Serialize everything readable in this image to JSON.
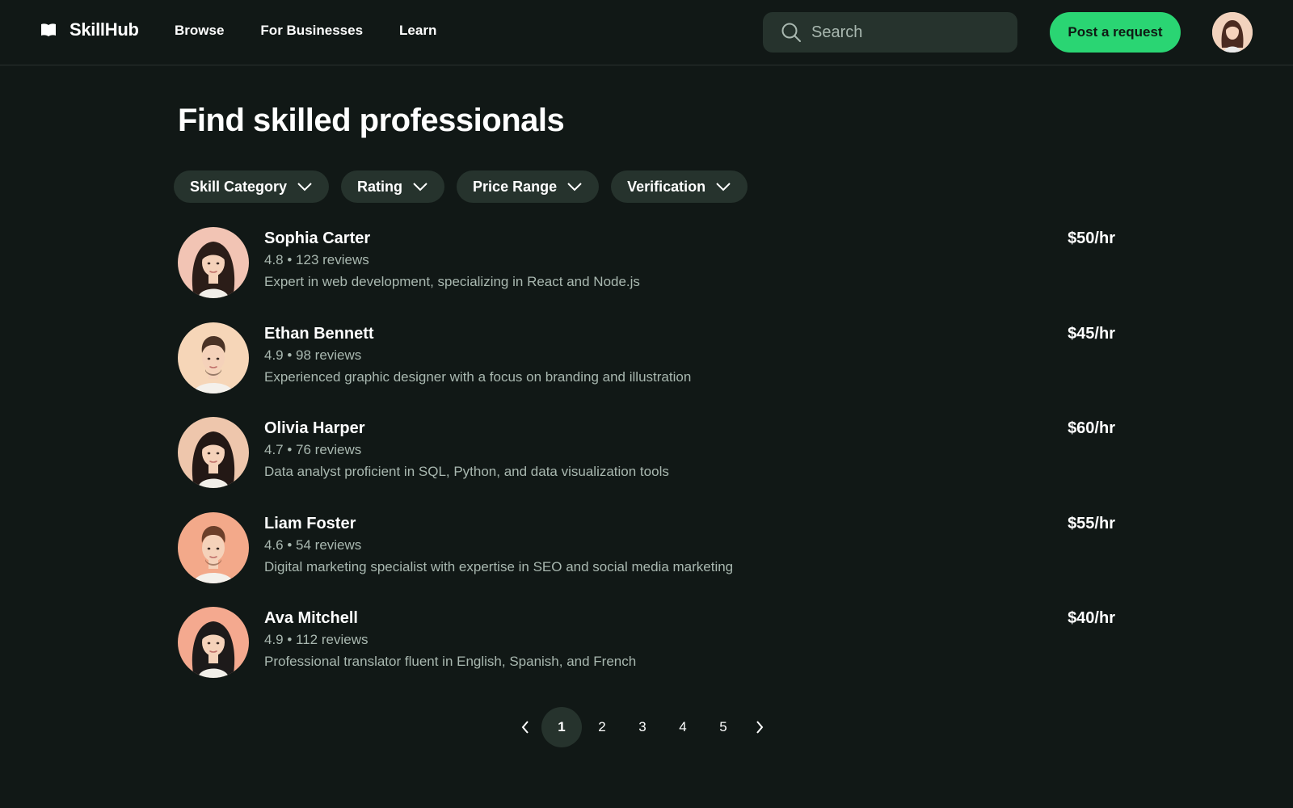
{
  "header": {
    "brand": "SkillHub",
    "nav": [
      "Browse",
      "For Businesses",
      "Learn"
    ],
    "search_placeholder": "Search",
    "post_button": "Post a request"
  },
  "main": {
    "title": "Find skilled professionals",
    "filters": [
      "Skill Category",
      "Rating",
      "Price Range",
      "Verification"
    ],
    "professionals": [
      {
        "name": "Sophia Carter",
        "rating": "4.8",
        "reviews": "123 reviews",
        "rating_line": "4.8 • 123 reviews",
        "description": "Expert in web development, specializing in React and Node.js",
        "price": "$50/hr",
        "avatar_bg": "#f2c4b4",
        "gender": "female",
        "hair": "#2b1d18"
      },
      {
        "name": "Ethan Bennett",
        "rating": "4.9",
        "reviews": "98 reviews",
        "rating_line": "4.9 • 98 reviews",
        "description": "Experienced graphic designer with a focus on branding and illustration",
        "price": "$45/hr",
        "avatar_bg": "#f6d6b8",
        "gender": "male",
        "hair": "#4a3326"
      },
      {
        "name": "Olivia Harper",
        "rating": "4.7",
        "reviews": "76 reviews",
        "rating_line": "4.7 • 76 reviews",
        "description": "Data analyst proficient in SQL, Python, and data visualization tools",
        "price": "$60/hr",
        "avatar_bg": "#eec6ac",
        "gender": "female",
        "hair": "#231815"
      },
      {
        "name": "Liam Foster",
        "rating": "4.6",
        "reviews": "54 reviews",
        "rating_line": "4.6 • 54 reviews",
        "description": "Digital marketing specialist with expertise in SEO and social media marketing",
        "price": "$55/hr",
        "avatar_bg": "#f3a98a",
        "gender": "male",
        "hair": "#6b3f2a"
      },
      {
        "name": "Ava Mitchell",
        "rating": "4.9",
        "reviews": "112 reviews",
        "rating_line": "4.9 • 112 reviews",
        "description": "Professional translator fluent in English, Spanish, and French",
        "price": "$40/hr",
        "avatar_bg": "#f4a98f",
        "gender": "female",
        "hair": "#1d1a1a"
      }
    ]
  },
  "pagination": {
    "pages": [
      "1",
      "2",
      "3",
      "4",
      "5"
    ],
    "active": "1"
  },
  "colors": {
    "background": "#111816",
    "surface": "#26332d",
    "accent": "#2ad573",
    "muted_text": "#a9b8b0"
  },
  "icons": [
    "book-logo-icon",
    "search-icon",
    "chevron-down-icon",
    "chevron-left-icon",
    "chevron-right-icon"
  ]
}
